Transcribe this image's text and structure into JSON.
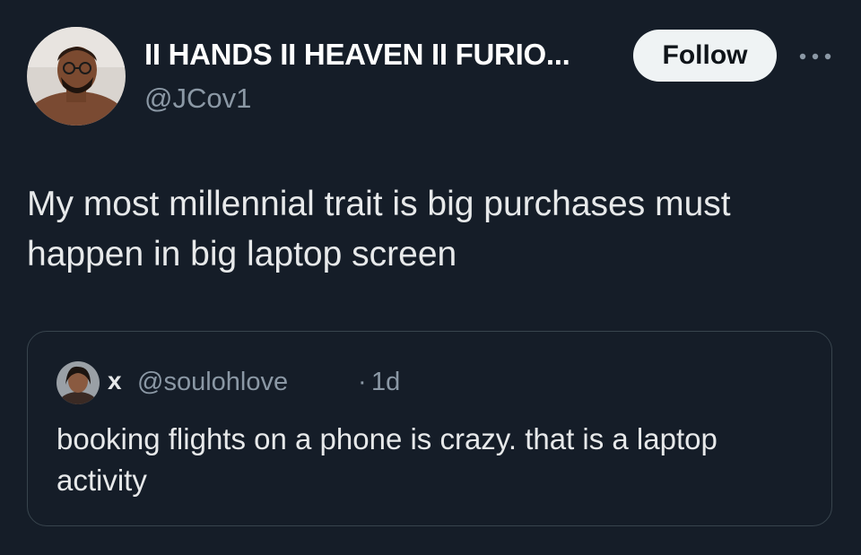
{
  "tweet": {
    "author": {
      "display_name": "II HANDS II HEAVEN II FURIO...",
      "handle": "@JCov1",
      "avatar_icon": "profile-photo"
    },
    "follow_label": "Follow",
    "more_icon": "more-icon",
    "text": "My most millennial trait is big purchases must\nhappen in big laptop screen",
    "quoted": {
      "display_name": "x",
      "handle": "@soulohlove",
      "separator": "·",
      "time": "1d",
      "text": "booking flights on a phone is crazy. that is a laptop\nactivity",
      "avatar_icon": "profile-photo"
    }
  },
  "colors": {
    "background": "#151d28",
    "primary_text": "#e7e9ea",
    "secondary_text": "#8b98a5",
    "follow_button_bg": "#eff3f4",
    "border": "#38444d"
  }
}
